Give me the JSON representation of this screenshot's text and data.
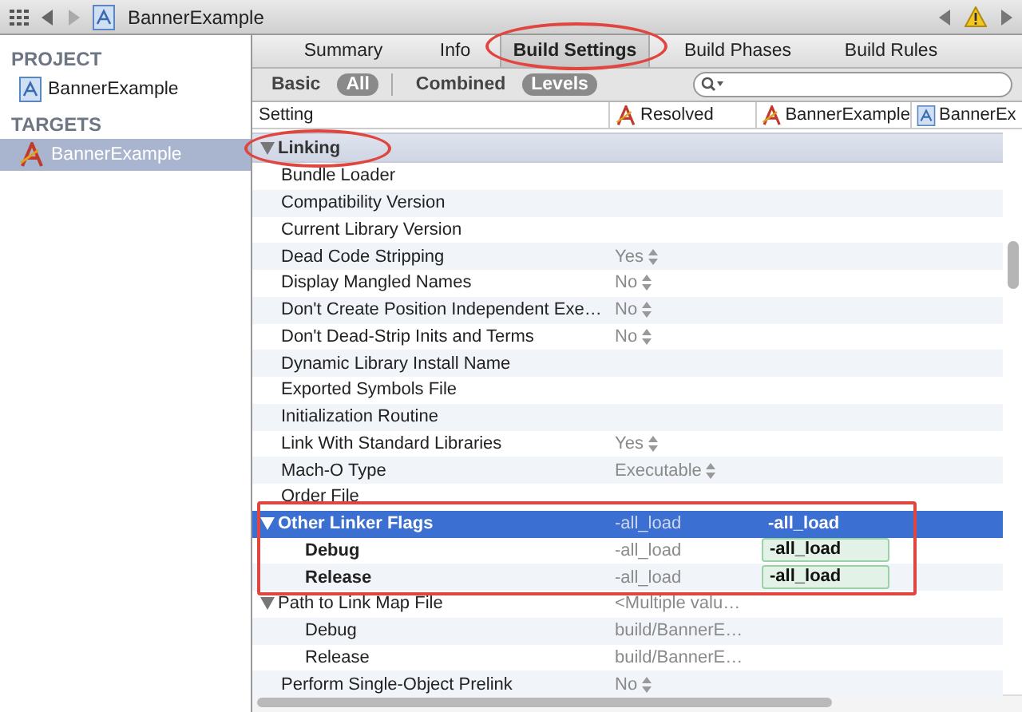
{
  "jump_bar": {
    "title": "BannerExample"
  },
  "sidebar": {
    "sections": [
      {
        "heading": "PROJECT",
        "items": [
          {
            "label": "BannerExample",
            "kind": "project",
            "selected": false
          }
        ]
      },
      {
        "heading": "TARGETS",
        "items": [
          {
            "label": "BannerExample",
            "kind": "target",
            "selected": true
          }
        ]
      }
    ]
  },
  "tabs": [
    {
      "label": "Summary",
      "selected": false
    },
    {
      "label": "Info",
      "selected": false
    },
    {
      "label": "Build Settings",
      "selected": true
    },
    {
      "label": "Build Phases",
      "selected": false
    },
    {
      "label": "Build Rules",
      "selected": false
    }
  ],
  "scope_filters": [
    {
      "label": "Basic",
      "selected": false
    },
    {
      "label": "All",
      "selected": true
    }
  ],
  "view_filters": [
    {
      "label": "Combined",
      "selected": false
    },
    {
      "label": "Levels",
      "selected": true
    }
  ],
  "columns": [
    {
      "label": "Setting",
      "kind": "plain"
    },
    {
      "label": "Resolved",
      "kind": "target"
    },
    {
      "label": "BannerExample",
      "kind": "target"
    },
    {
      "label": "BannerEx",
      "kind": "project"
    }
  ],
  "section": {
    "title": "Linking",
    "expanded": true
  },
  "rows": [
    {
      "name": "Bundle Loader",
      "kind": "text",
      "selected": false
    },
    {
      "name": "Compatibility Version",
      "kind": "text",
      "selected": false
    },
    {
      "name": "Current Library Version",
      "kind": "text",
      "selected": false
    },
    {
      "name": "Dead Code Stripping",
      "kind": "enum",
      "resolved": "Yes",
      "selected": false
    },
    {
      "name": "Display Mangled Names",
      "kind": "enum",
      "resolved": "No",
      "selected": false
    },
    {
      "name": "Don't Create Position Independent Exe…",
      "kind": "enum",
      "resolved": "No",
      "selected": false
    },
    {
      "name": "Don't Dead-Strip Inits and Terms",
      "kind": "enum",
      "resolved": "No",
      "selected": false
    },
    {
      "name": "Dynamic Library Install Name",
      "kind": "text",
      "selected": false
    },
    {
      "name": "Exported Symbols File",
      "kind": "text",
      "selected": false
    },
    {
      "name": "Initialization Routine",
      "kind": "text",
      "selected": false
    },
    {
      "name": "Link With Standard Libraries",
      "kind": "enum",
      "resolved": "Yes",
      "selected": false
    },
    {
      "name": "Mach-O Type",
      "kind": "enum",
      "resolved": "Executable",
      "selected": false
    },
    {
      "name": "Order File",
      "kind": "text",
      "selected": false
    },
    {
      "name": "Other Linker Flags",
      "kind": "group",
      "expanded": true,
      "resolved": "-all_load",
      "target": "-all_load",
      "selected": true
    },
    {
      "name": "Debug",
      "kind": "config",
      "modified": true,
      "resolved": "-all_load",
      "target": "-all_load",
      "selected": false
    },
    {
      "name": "Release",
      "kind": "config",
      "modified": true,
      "resolved": "-all_load",
      "target": "-all_load",
      "selected": false
    },
    {
      "name": "Path to Link Map File",
      "kind": "group",
      "expanded": true,
      "resolved": "<Multiple valu…",
      "selected": false
    },
    {
      "name": "Debug",
      "kind": "config",
      "modified": false,
      "resolved": "build/BannerE…",
      "selected": false
    },
    {
      "name": "Release",
      "kind": "config",
      "modified": false,
      "resolved": "build/BannerE…",
      "selected": false
    },
    {
      "name": "Perform Single-Object Prelink",
      "kind": "enum",
      "resolved": "No",
      "selected": false
    }
  ]
}
